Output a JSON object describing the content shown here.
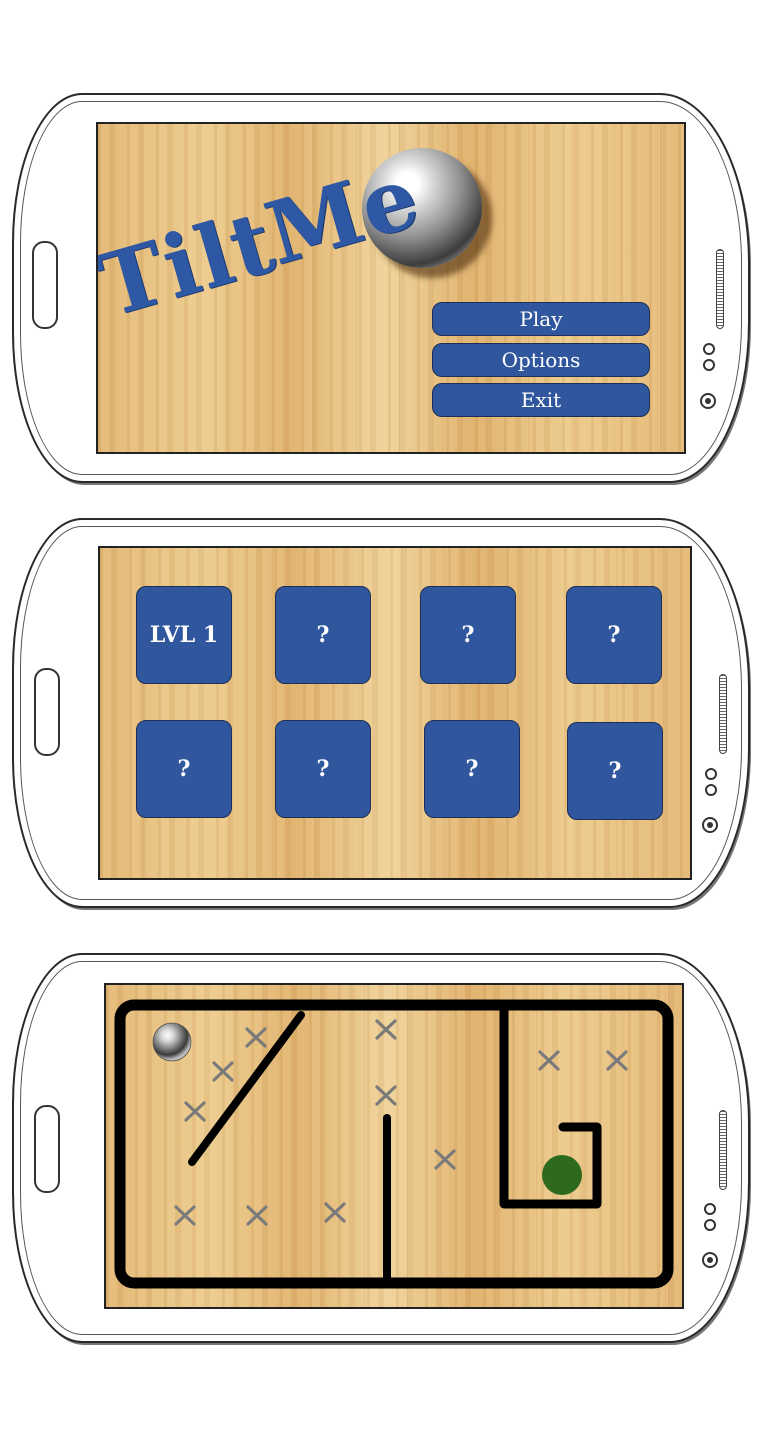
{
  "screens": {
    "main_menu": {
      "title_word_1": "Tilt",
      "title_word_2": "Me",
      "buttons": [
        "Play",
        "Options",
        "Exit"
      ]
    },
    "level_select": {
      "levels": [
        "LVL 1",
        "?",
        "?",
        "?",
        "?",
        "?",
        "?",
        "?"
      ]
    },
    "game": {
      "hazard_symbol": "×",
      "wall_color": "#000000",
      "goal_color": "#2e6a1e",
      "hazard_color": "#7a7a7a"
    }
  },
  "theme": {
    "button_color": "#30579e",
    "title_color": "#2f58a4"
  }
}
